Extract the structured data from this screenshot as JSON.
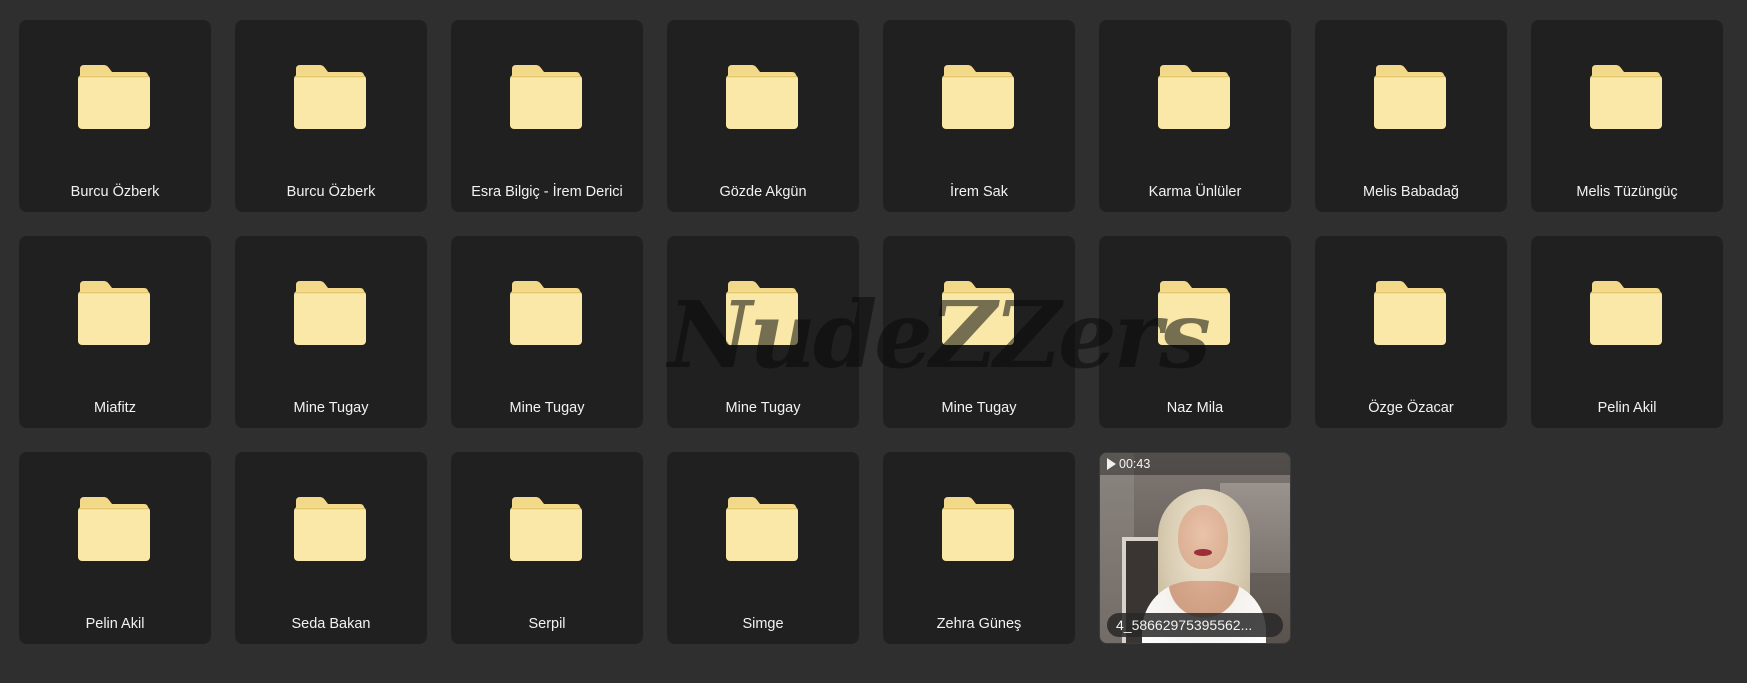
{
  "folders": [
    {
      "name": "Burcu Özberk",
      "icon": "folder-icon"
    },
    {
      "name": "Burcu Özberk",
      "icon": "folder-icon"
    },
    {
      "name": "Esra Bilgiç - İrem Derici",
      "icon": "folder-icon"
    },
    {
      "name": "Gözde Akgün",
      "icon": "folder-icon"
    },
    {
      "name": "İrem Sak",
      "icon": "folder-icon"
    },
    {
      "name": "Karma Ünlüler",
      "icon": "folder-icon"
    },
    {
      "name": "Melis Babadağ",
      "icon": "folder-icon"
    },
    {
      "name": "Melis Tüzüngüç",
      "icon": "folder-icon"
    },
    {
      "name": "Miafitz",
      "icon": "folder-icon"
    },
    {
      "name": "Mine Tugay",
      "icon": "folder-icon"
    },
    {
      "name": "Mine Tugay",
      "icon": "folder-icon"
    },
    {
      "name": "Mine Tugay",
      "icon": "folder-icon"
    },
    {
      "name": "Mine Tugay",
      "icon": "folder-icon"
    },
    {
      "name": "Naz Mila",
      "icon": "folder-icon"
    },
    {
      "name": "Özge Özacar",
      "icon": "folder-icon"
    },
    {
      "name": "Pelin Akil",
      "icon": "folder-icon"
    },
    {
      "name": "Pelin Akil",
      "icon": "folder-icon"
    },
    {
      "name": "Seda Bakan",
      "icon": "folder-icon"
    },
    {
      "name": "Serpil",
      "icon": "folder-icon"
    },
    {
      "name": "Simge",
      "icon": "folder-icon"
    },
    {
      "name": "Zehra Güneş",
      "icon": "folder-icon"
    }
  ],
  "video": {
    "duration": "00:43",
    "filename": "4_58662975395562...",
    "icon": "play-icon"
  },
  "watermark": "NudeZZers",
  "colors": {
    "background": "#2f2f2f",
    "tile": "#202020",
    "folder_body": "#f9e8a8",
    "folder_tab": "#f2d98a",
    "folder_line": "#e2c46a",
    "text": "#f2f2f2"
  }
}
